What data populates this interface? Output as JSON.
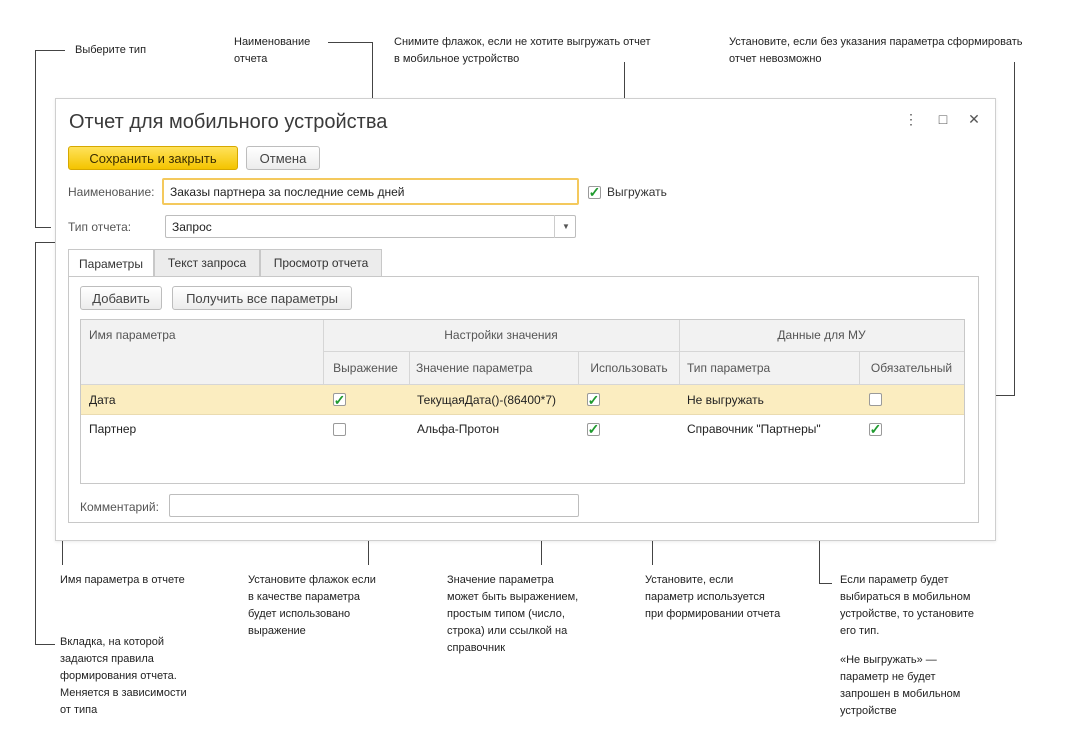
{
  "annotations": {
    "type": "Выберите тип",
    "name": "Наименование\nотчета",
    "export": "Снимите флажок, если не хотите выгружать отчет\nв мобильное устройство",
    "required": "Установите, если без указания параметра сформировать\nотчет невозможно",
    "param_name": "Имя параметра в отчете",
    "expression": "Установите флажок если\nв качестве параметра\nбудет использовано\nвыражение",
    "value": "Значение параметра\nможет быть выражением,\nпростым типом (число,\nстрока) или ссылкой на\nсправочник",
    "use": "Установите, если\nпараметр используется\nпри формировании отчета",
    "param_type": "Если параметр будет\nвыбираться в мобильном\nустройстве, то установите\nего тип.",
    "no_export": "«Не выгружать» —\nпараметр не будет\nзапрошен в мобильном\nустройстве",
    "tab": "Вкладка, на которой\nзадаются правила\nформирования отчета.\nМеняется в зависимости\nот типа"
  },
  "window": {
    "title": "Отчет для мобильного устройства",
    "menu_icon": "⋮",
    "maximize_icon": "□",
    "close_icon": "✕"
  },
  "toolbar": {
    "save_close": "Сохранить и закрыть",
    "cancel": "Отмена"
  },
  "form": {
    "name_label": "Наименование:",
    "name_value": "Заказы партнера за последние семь дней",
    "export_label": "Выгружать",
    "export_checked": true,
    "type_label": "Тип отчета:",
    "type_value": "Запрос",
    "comment_label": "Комментарий:",
    "comment_value": ""
  },
  "tabs": [
    {
      "label": "Параметры",
      "active": true
    },
    {
      "label": "Текст запроса",
      "active": false
    },
    {
      "label": "Просмотр отчета",
      "active": false
    }
  ],
  "params_toolbar": {
    "add": "Добавить",
    "get_all": "Получить все параметры"
  },
  "table": {
    "group_value": "Настройки значения",
    "group_mu": "Данные для МУ",
    "col_name": "Имя параметра",
    "col_expr": "Выражение",
    "col_value": "Значение параметра",
    "col_use": "Использовать",
    "col_type": "Тип параметра",
    "col_required": "Обязательный",
    "rows": [
      {
        "name": "Дата",
        "expr": true,
        "value": "ТекущаяДата()-(86400*7)",
        "use": true,
        "type": "Не выгружать",
        "required": false
      },
      {
        "name": "Партнер",
        "expr": false,
        "value": "Альфа-Протон",
        "use": true,
        "type": "Справочник \"Партнеры\"",
        "required": true
      }
    ]
  },
  "colors": {
    "accent": "#f4c400",
    "selected_row": "#fbedc0",
    "check": "#1f9a2e"
  }
}
